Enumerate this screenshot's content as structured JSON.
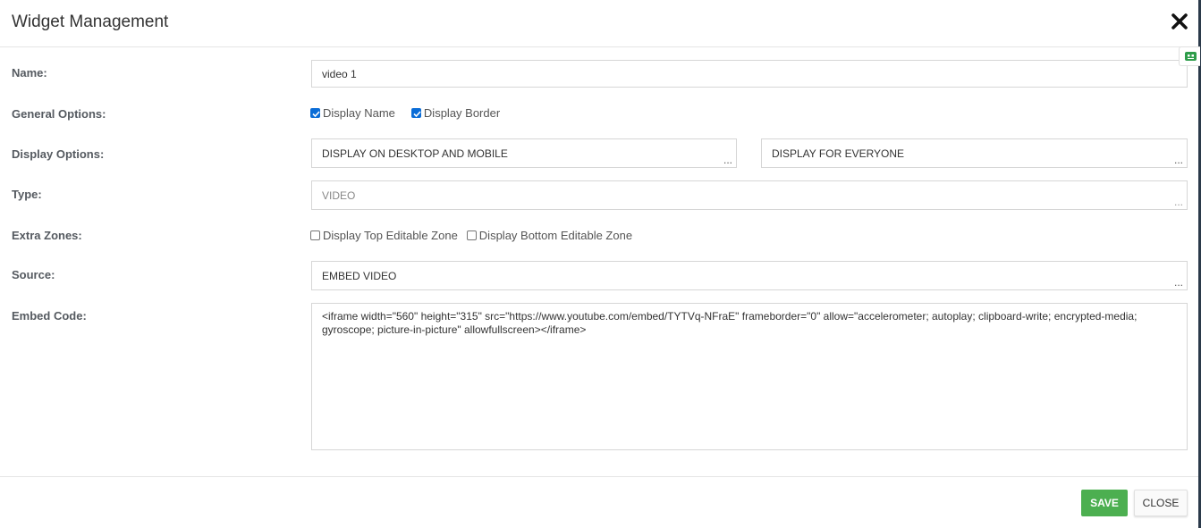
{
  "header": {
    "title": "Widget Management"
  },
  "form": {
    "name": {
      "label": "Name:",
      "value": "video 1"
    },
    "general_options": {
      "label": "General Options:",
      "display_name_label": "Display Name",
      "display_name_checked": true,
      "display_border_label": "Display Border",
      "display_border_checked": true
    },
    "display_options": {
      "label": "Display Options:",
      "device_value": "DISPLAY ON DESKTOP AND MOBILE",
      "audience_value": "DISPLAY FOR EVERYONE",
      "picker_glyph": "..."
    },
    "type": {
      "label": "Type:",
      "value": "VIDEO",
      "picker_glyph": "..."
    },
    "extra_zones": {
      "label": "Extra Zones:",
      "top_label": "Display Top Editable Zone",
      "top_checked": false,
      "bottom_label": "Display Bottom Editable Zone",
      "bottom_checked": false
    },
    "source": {
      "label": "Source:",
      "value": "EMBED VIDEO",
      "picker_glyph": "..."
    },
    "embed_code": {
      "label": "Embed Code:",
      "value": "<iframe width=\"560\" height=\"315\" src=\"https://www.youtube.com/embed/TYTVq-NFraE\" frameborder=\"0\" allow=\"accelerometer; autoplay; clipboard-write; encrypted-media; gyroscope; picture-in-picture\" allowfullscreen></iframe>"
    }
  },
  "footer": {
    "save_label": "SAVE",
    "close_label": "CLOSE"
  },
  "colors": {
    "save_button": "#4caf50",
    "checkbox_checked": "#0b6dd7",
    "side_widget_icon": "#2e9d4a"
  },
  "icons": {
    "close": "close-icon",
    "side_widget": "robot-chat-icon"
  }
}
